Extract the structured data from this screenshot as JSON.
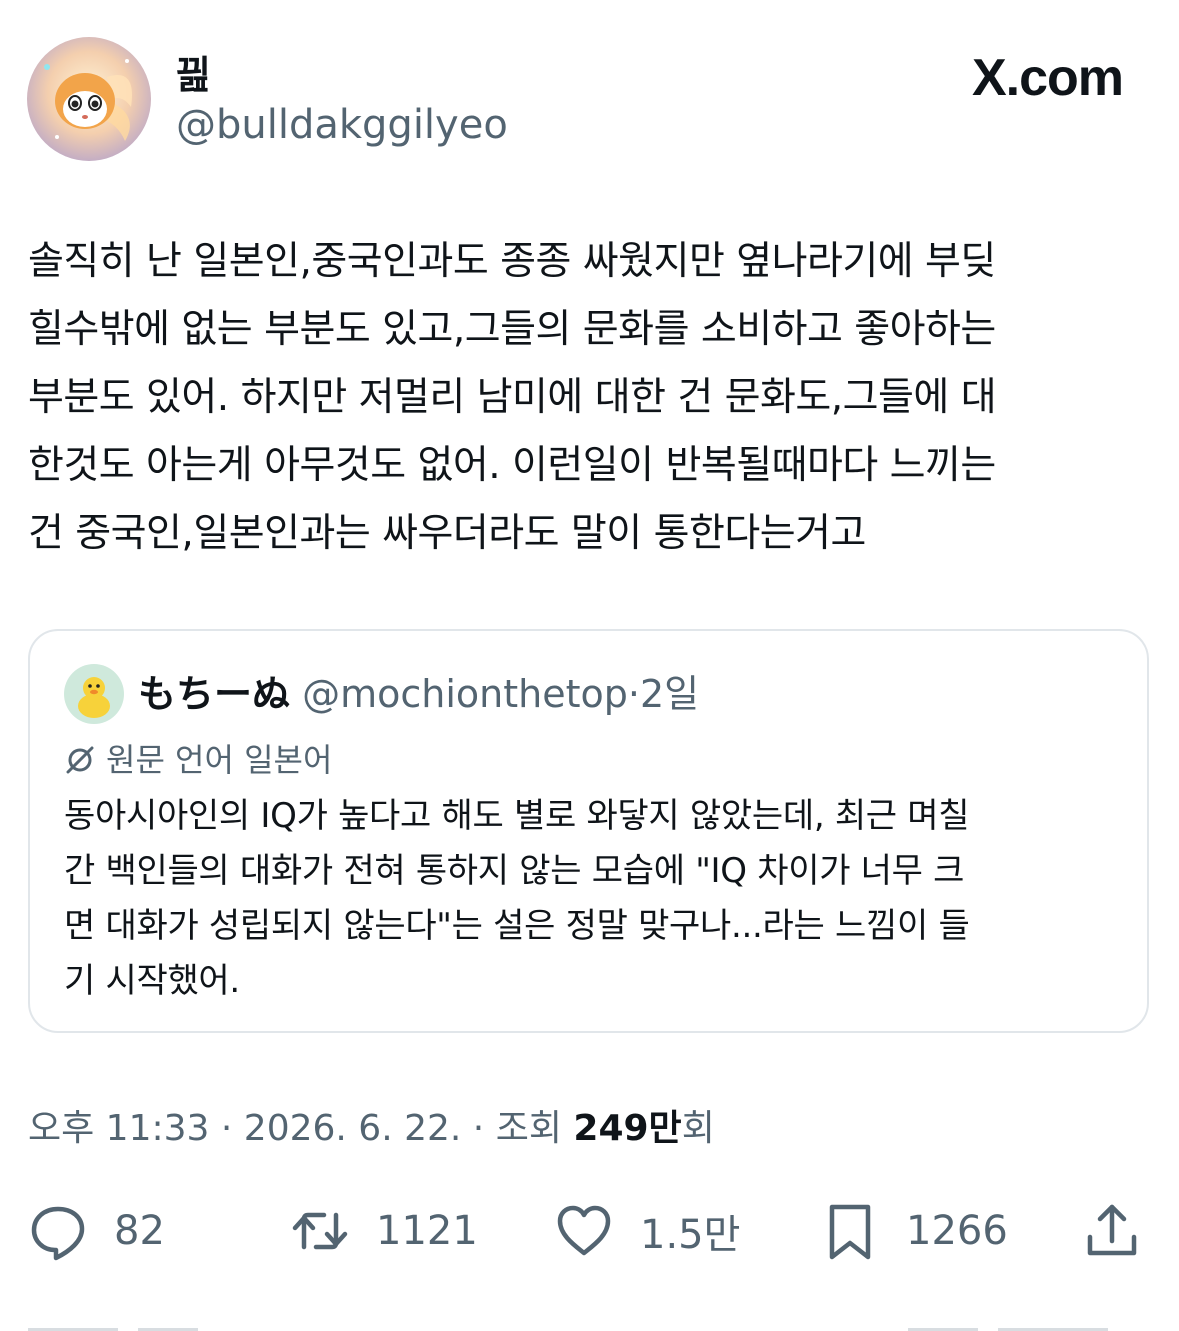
{
  "author": {
    "display_name": "끮",
    "handle": "@bulldakggilyeo"
  },
  "brand": {
    "label": "X.com",
    "x": "X",
    "rest": ".com"
  },
  "tweet": {
    "text": "솔직히 난 일본인,중국인과도 종종 싸웠지만 옆나라기에 부딪\n힐수밖에 없는 부분도 있고,그들의 문화를 소비하고 좋아하는\n부분도 있어. 하지만 저멀리 남미에 대한 건 문화도,그들에 대\n한것도 아는게 아무것도 없어. 이런일이 반복될때마다 느끼는\n건 중국인,일본인과는 싸우더라도 말이 통한다는거고"
  },
  "quoted_tweet": {
    "display_name": "もちーぬ",
    "handle": "@mochionthetop",
    "separator": "·",
    "time": "2일",
    "language_note": "원문 언어 일본어",
    "text": "동아시아인의 IQ가 높다고 해도 별로 와닿지 않았는데, 최근 며칠\n간 백인들의 대화가 전혀 통하지 않는 모습에 \"IQ 차이가 너무 크\n면 대화가 성립되지 않는다\"는 설은 정말 맞구나...라는 느낌이 들\n기 시작했어."
  },
  "meta": {
    "time": "오후 11:33",
    "sep1": "·",
    "date": "2026. 6. 22.",
    "sep2": "·",
    "views_label": "조회",
    "views_count": "249만",
    "views_suffix": "회"
  },
  "actions": {
    "replies": "82",
    "retweets": "1121",
    "likes": "1.5만",
    "bookmarks": "1266"
  },
  "icons": {
    "reply": "reply-icon",
    "retweet": "retweet-icon",
    "like": "heart-icon",
    "bookmark": "bookmark-icon",
    "share": "share-icon",
    "translate": "translate-icon"
  },
  "colors": {
    "text": "#0f1419",
    "secondary": "#536471",
    "border": "#e1e6ea"
  }
}
